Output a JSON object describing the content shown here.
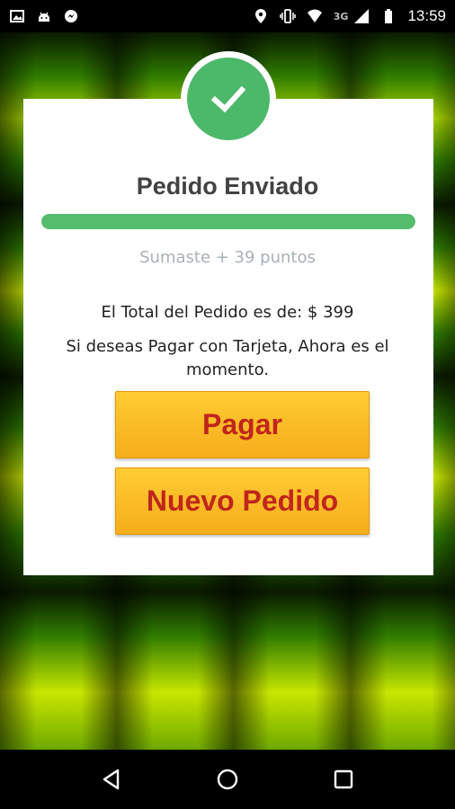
{
  "status_bar": {
    "left_icons": [
      "image-notification-icon",
      "android-debug-icon",
      "messenger-notification-icon"
    ],
    "right_icons": [
      "location-icon",
      "vibrate-icon",
      "wifi-icon",
      "cell-signal-icon",
      "battery-icon"
    ],
    "network_type": "3G",
    "time": "13:59"
  },
  "dialog": {
    "status_icon": "check-icon",
    "title": "Pedido Enviado",
    "progress": 1.0,
    "points_text": "Sumaste + 39 puntos",
    "total_text": "El Total del Pedido es de: $ 399",
    "message": "Si deseas Pagar con Tarjeta, Ahora es el momento.",
    "pay_button": "Pagar",
    "new_order_button": "Nuevo Pedido"
  },
  "nav_bar": {
    "buttons": [
      "back-icon",
      "home-icon",
      "recents-icon"
    ]
  },
  "colors": {
    "success_green": "#4cb86a",
    "button_yellow": "#f6ad1c",
    "button_text_red": "#c0261c",
    "background_green": "#7fc400"
  }
}
